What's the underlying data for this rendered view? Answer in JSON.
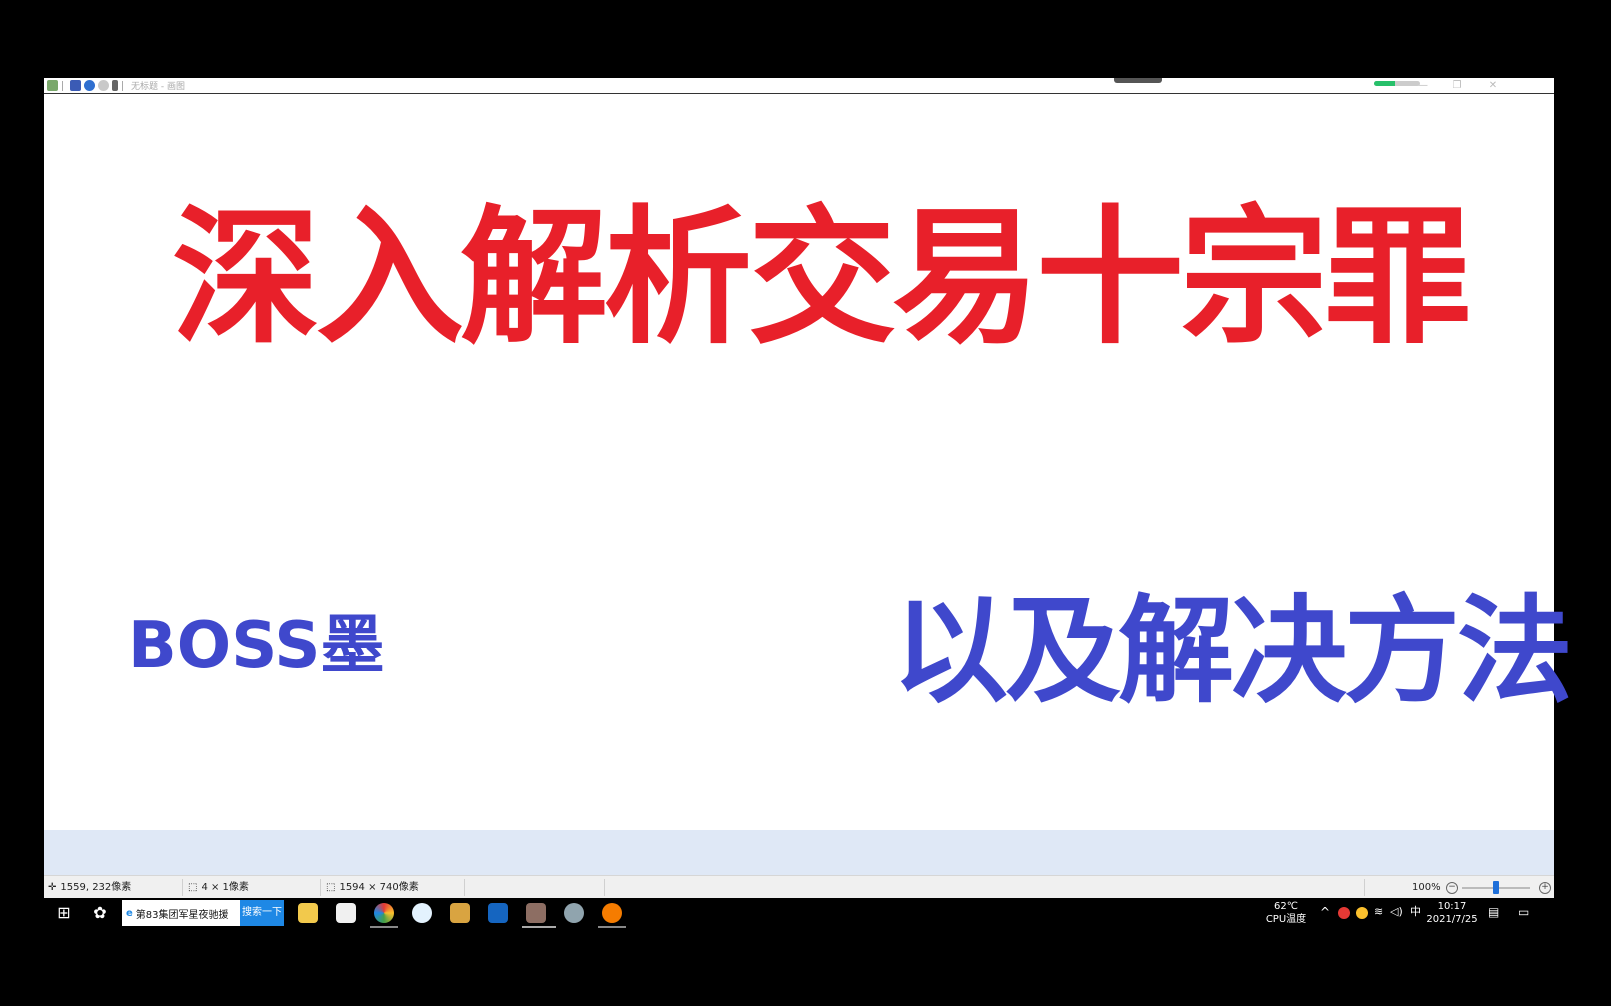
{
  "window": {
    "title": "无标题 - 画图",
    "minimize": "—",
    "maximize": "❐",
    "close": "✕",
    "progress": 0.45
  },
  "canvas": {
    "title": "深入解析交易十宗罪",
    "author": "BOSS墨",
    "subtitle": "以及解决方法",
    "title_color": "#e8202a",
    "text_color": "#3f48cc"
  },
  "statusbar": {
    "cursor_pos": "1559, 232像素",
    "selection_size": "4 × 1像素",
    "image_size": "1594 × 740像素",
    "zoom": "100%",
    "zoom_out": "−",
    "zoom_in": "+"
  },
  "taskbar": {
    "search_text": "第83集团军星夜驰援",
    "search_button": "搜索一下",
    "cpu_temp": "62℃",
    "cpu_label": "CPU温度",
    "ime": "中",
    "time": "10:17",
    "date": "2021/7/25"
  }
}
